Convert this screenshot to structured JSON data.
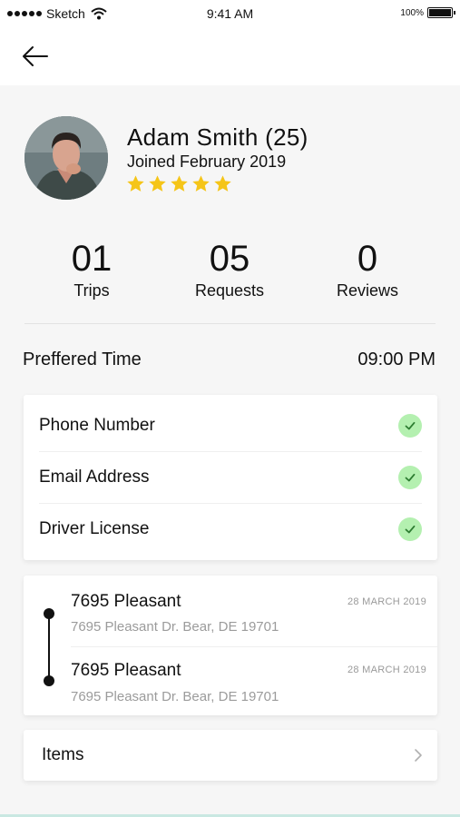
{
  "status_bar": {
    "carrier": "Sketch",
    "time": "9:41 AM",
    "battery": "100%"
  },
  "nav": {
    "back_icon": "arrow-left-icon"
  },
  "profile": {
    "name": "Adam Smith (25)",
    "joined": "Joined February 2019",
    "rating": 5,
    "star_color": "#f5c518"
  },
  "stats": [
    {
      "value": "01",
      "label": "Trips"
    },
    {
      "value": "05",
      "label": "Requests"
    },
    {
      "value": "0",
      "label": "Reviews"
    }
  ],
  "preferred": {
    "label": "Preffered Time",
    "value": "09:00 PM"
  },
  "verifications": [
    {
      "label": "Phone Number",
      "verified": true
    },
    {
      "label": "Email Address",
      "verified": true
    },
    {
      "label": "Driver License",
      "verified": true
    }
  ],
  "route": [
    {
      "title": "7695 Pleasant",
      "date": "28 MARCH 2019",
      "address": "7695 Pleasant Dr. Bear, DE 19701"
    },
    {
      "title": "7695 Pleasant",
      "date": "28 MARCH 2019",
      "address": "7695 Pleasant Dr. Bear, DE 19701"
    }
  ],
  "items": {
    "label": "Items",
    "icon": "chevron-right-icon"
  },
  "colors": {
    "check_bg": "#b4f0b0",
    "check_mark": "#2e7d32",
    "muted_text": "#9b9b9b"
  }
}
